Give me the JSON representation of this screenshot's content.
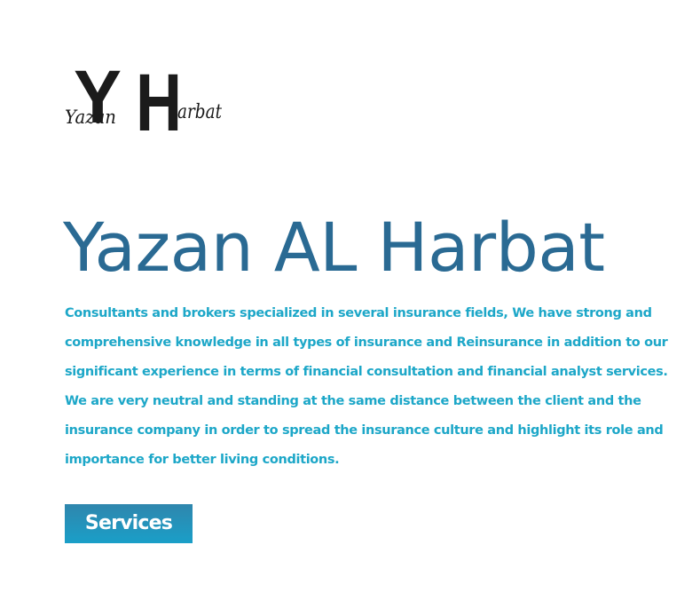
{
  "brand": {
    "logo_name": "Yazan",
    "logo_monogram_y": "Y",
    "logo_monogram_h": "H",
    "logo_surname": "arbat"
  },
  "hero": {
    "title": "Yazan AL Harbat",
    "description": "Consultants and brokers specialized in several insurance fields, We have strong and comprehensive knowledge in all types of insurance and Reinsurance in addition to our significant experience in terms of financial consultation and financial analyst services. We are very neutral and standing at the same distance between the client and the insurance company in order to spread the insurance culture and highlight its role and importance for better living conditions.",
    "button_label": "Services"
  },
  "colors": {
    "title": "#2a6a93",
    "text": "#1da7c8",
    "button_top": "#2f86ad",
    "button_bottom": "#1a9fc8",
    "logo": "#1b1b1b"
  }
}
